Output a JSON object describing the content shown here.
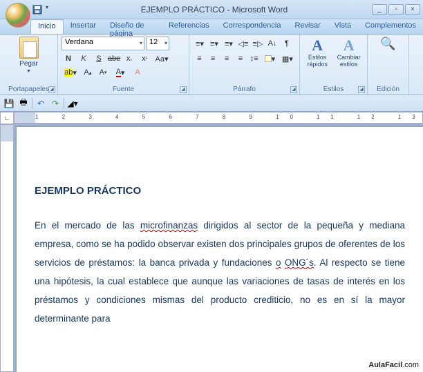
{
  "title": "EJEMPLO PRÁCTICO - Microsoft Word",
  "tabs": [
    "Inicio",
    "Insertar",
    "Diseño de página",
    "Referencias",
    "Correspondencia",
    "Revisar",
    "Vista",
    "Complementos"
  ],
  "active_tab": 0,
  "ribbon": {
    "clipboard": {
      "label": "Portapapeles",
      "paste": "Pegar"
    },
    "font": {
      "label": "Fuente",
      "name": "Verdana",
      "size": "12"
    },
    "paragraph": {
      "label": "Párrafo"
    },
    "styles": {
      "label": "Estilos",
      "quick": "Estilos rápidos",
      "change": "Cambiar estilos"
    },
    "editing": {
      "label": "Edición"
    }
  },
  "ruler": "1 2 3 4 5 6 7 8 9 10 11 12 13 14",
  "document": {
    "heading": "EJEMPLO PRÁCTICO",
    "p1a": "En el mercado de las ",
    "p1_mf": "microfinanzas",
    "p1b": " dirigidos al sector de la pequeña y mediana empresa, como se ha podido observar existen dos principales grupos de oferentes de los servicios de préstamos: la banca privada y fundaciones ",
    "p1_o": "o",
    "p1c": " ",
    "p1_ong": "ONG´s",
    "p1d": ". Al respecto se tiene una hipótesis, la cual establece que aunque las variaciones de tasas de interés en los préstamos y condiciones mismas del producto crediticio, no es en sí la mayor determinante para"
  },
  "watermark": {
    "a": "AulaFacil",
    "b": ".com"
  }
}
